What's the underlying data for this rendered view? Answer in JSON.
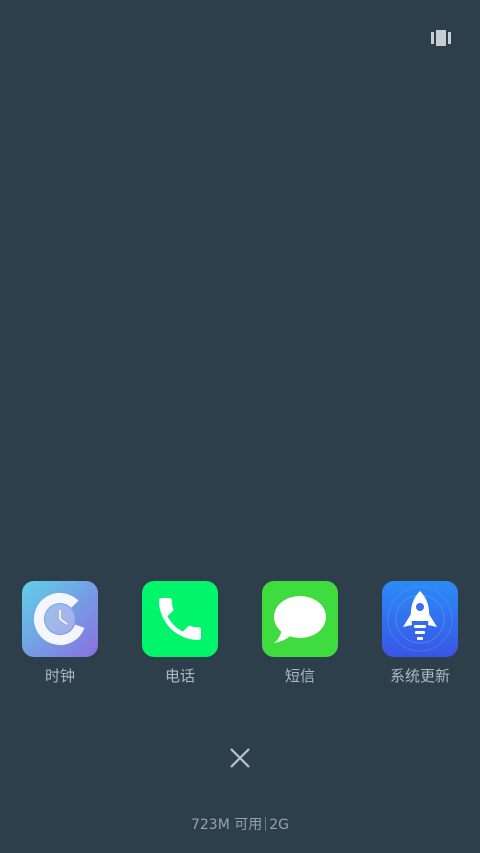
{
  "top_right": {
    "icon": "card-view-icon"
  },
  "apps": [
    {
      "label": "时钟",
      "icon": "clock-app-icon"
    },
    {
      "label": "电话",
      "icon": "phone-app-icon"
    },
    {
      "label": "短信",
      "icon": "messages-app-icon"
    },
    {
      "label": "系统更新",
      "icon": "system-update-app-icon"
    }
  ],
  "close": {
    "icon": "close-icon"
  },
  "memory": {
    "available": "723M 可用",
    "total": "2G"
  },
  "colors": {
    "background": "#2e3f4c",
    "phone_green": "#00f56a",
    "messages_green": "#3edc3e",
    "update_blue": "#2f6bf0"
  }
}
